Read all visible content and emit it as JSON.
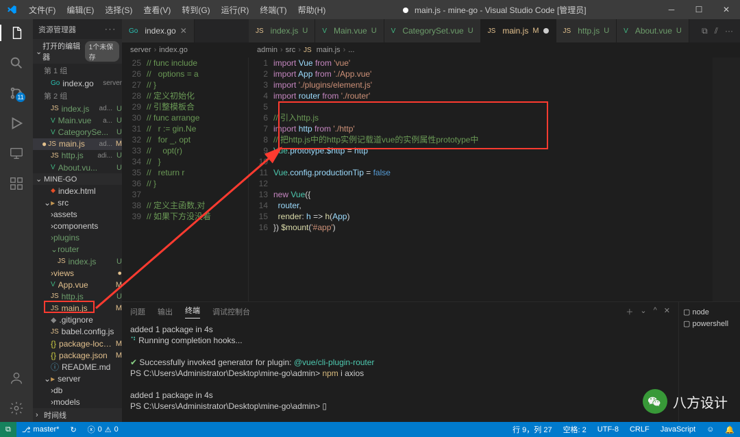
{
  "menu": [
    "文件(F)",
    "编辑(E)",
    "选择(S)",
    "查看(V)",
    "转到(G)",
    "运行(R)",
    "终端(T)",
    "帮助(H)"
  ],
  "title": {
    "filename": "main.js",
    "project": "mine-go",
    "app": "Visual Studio Code",
    "suffix": "[管理员]"
  },
  "sidebar": {
    "header": "资源管理器",
    "openEditors": {
      "label": "打开的编辑器",
      "badge": "1个未保存"
    },
    "groups": {
      "g1": "第 1 组",
      "g2": "第 2 组",
      "indexGo": {
        "name": "index.go",
        "dir": "server"
      },
      "indexJs": {
        "name": "index.js",
        "dir": "ad...",
        "stat": "U"
      },
      "mainVue": {
        "name": "Main.vue",
        "dir": "a...",
        "stat": "U"
      },
      "catSet": {
        "name": "CategorySe...",
        "stat": "U"
      },
      "mainJsOE": {
        "name": "main.js",
        "dir": "ad...",
        "stat": "M"
      },
      "httpJs": {
        "name": "http.js",
        "dir": "adi...",
        "stat": "U"
      },
      "aboutVue": {
        "name": "About.vu...",
        "stat": "U"
      }
    },
    "project": "MINE-GO",
    "tree": {
      "indexHtml": "index.html",
      "srcFolder": "src",
      "assets": "assets",
      "components": "components",
      "plugins": "plugins",
      "routerFolder": "router",
      "routerIndex": {
        "name": "index.js",
        "stat": "U"
      },
      "views": {
        "name": "views",
        "stat": "●"
      },
      "appVue": {
        "name": "App.vue",
        "stat": "M"
      },
      "httpJs": {
        "name": "http.js",
        "stat": "U"
      },
      "mainJs": {
        "name": "main.js",
        "stat": "M"
      },
      "gitignore": ".gitignore",
      "babel": {
        "name": "babel.config.js"
      },
      "pkgLock": {
        "name": "package-lock.j...",
        "stat": "M"
      },
      "pkg": {
        "name": "package.json",
        "stat": "M"
      },
      "readme": "README.md",
      "serverFolder": "server",
      "db": "db",
      "models": "models",
      "timeline": "时间线"
    }
  },
  "tabsLeft": [
    {
      "icon": "go",
      "name": "index.go",
      "close": true
    }
  ],
  "tabsRight": [
    {
      "icon": "js",
      "name": "index.js",
      "stat": "U",
      "cls": "u"
    },
    {
      "icon": "vue",
      "name": "Main.vue",
      "stat": "U",
      "cls": "u"
    },
    {
      "icon": "vue",
      "name": "CategorySet.vue",
      "stat": "U",
      "cls": "u"
    },
    {
      "icon": "js",
      "name": "main.js",
      "stat": "M",
      "cls": "m",
      "active": true,
      "dirty": true
    },
    {
      "icon": "js",
      "name": "http.js",
      "stat": "U",
      "cls": "u"
    },
    {
      "icon": "vue",
      "name": "About.vue",
      "stat": "U",
      "cls": "u"
    }
  ],
  "breadcrumbLeft": [
    "server",
    "index.go"
  ],
  "breadcrumbRight": [
    "admin",
    "src",
    "main.js",
    "..."
  ],
  "codeLeft": [
    {
      "n": 25,
      "html": "<span class='c-cmt'>// func include</span>"
    },
    {
      "n": 26,
      "html": "<span class='c-cmt'>//   options = a</span>"
    },
    {
      "n": 27,
      "html": "<span class='c-cmt'>// }</span>"
    },
    {
      "n": 28,
      "html": "<span class='c-cmt'>// 定义初始化</span>"
    },
    {
      "n": 29,
      "html": "<span class='c-cmt'>// 引整模板合</span>"
    },
    {
      "n": 30,
      "html": "<span class='c-cmt'>// func arrange</span>"
    },
    {
      "n": 31,
      "html": "<span class='c-cmt'>//   r := gin.Ne</span>"
    },
    {
      "n": 32,
      "html": "<span class='c-cmt'>//   for _, opt</span>"
    },
    {
      "n": 33,
      "html": "<span class='c-cmt'>//     opt(r)</span>"
    },
    {
      "n": 34,
      "html": "<span class='c-cmt'>//   }</span>"
    },
    {
      "n": 35,
      "html": "<span class='c-cmt'>//   return r</span>"
    },
    {
      "n": 36,
      "html": "<span class='c-cmt'>// }</span>"
    },
    {
      "n": 37,
      "html": ""
    },
    {
      "n": 38,
      "html": "<span class='c-cmt'>// 定义主函数,对</span>"
    },
    {
      "n": 39,
      "html": "<span class='c-cmt'>// 如果下方没没着</span>"
    }
  ],
  "codeRight": [
    {
      "n": 1,
      "html": "<span class='c-kw'>import</span> <span class='c-var'>Vue</span> <span class='c-kw'>from</span> <span class='c-str'>'vue'</span>"
    },
    {
      "n": 2,
      "html": "<span class='c-kw'>import</span> <span class='c-var'>App</span> <span class='c-kw'>from</span> <span class='c-str'>'./App.vue'</span>"
    },
    {
      "n": 3,
      "html": "<span class='c-kw'>import</span> <span class='c-str'>'./plugins/element.js'</span>"
    },
    {
      "n": 4,
      "html": "<span class='c-kw'>import</span> <span class='c-var'>router</span> <span class='c-kw'>from</span> <span class='c-str'>'./router'</span>"
    },
    {
      "n": 5,
      "html": ""
    },
    {
      "n": 6,
      "html": "<span class='c-cmt'>// 引入http.js</span>"
    },
    {
      "n": 7,
      "html": "<span class='c-kw'>import</span> <span class='c-var'>http</span> <span class='c-kw'>from</span> <span class='c-str'>'./http'</span>"
    },
    {
      "n": 8,
      "html": "<span class='c-cmt'>// 把http.js中的http实例记载道vue的实例属性prototype中</span>"
    },
    {
      "n": 9,
      "html": "<span class='c-cls'>Vue</span><span class='c-op'>.</span><span class='c-var'>prototype</span><span class='c-op'>.</span><span class='c-var'>$http</span> <span class='c-op'>=</span> <span class='c-var'>http</span>"
    },
    {
      "n": 10,
      "html": ""
    },
    {
      "n": 11,
      "html": "<span class='c-cls'>Vue</span><span class='c-op'>.</span><span class='c-var'>config</span><span class='c-op'>.</span><span class='c-var'>productionTip</span> <span class='c-op'>=</span> <span class='c-const'>false</span>"
    },
    {
      "n": 12,
      "html": ""
    },
    {
      "n": 13,
      "html": "<span class='c-kw'>new</span> <span class='c-cls'>Vue</span><span class='c-op'>({</span>"
    },
    {
      "n": 14,
      "html": "  <span class='c-var'>router</span><span class='c-op'>,</span>"
    },
    {
      "n": 15,
      "html": "  <span class='c-fn'>render</span><span class='c-op'>:</span> <span class='c-var'>h</span> <span class='c-op'>=></span> <span class='c-fn'>h</span><span class='c-op'>(</span><span class='c-var'>App</span><span class='c-op'>)</span>"
    },
    {
      "n": 16,
      "html": "<span class='c-op'>}) </span><span class='c-fn'>$mount</span><span class='c-op'>(</span><span class='c-str'>'#app'</span><span class='c-op'>)</span>"
    }
  ],
  "panel": {
    "tabs": [
      "问题",
      "输出",
      "终端",
      "调试控制台"
    ],
    "lines": [
      {
        "html": "added 1 package in 4s"
      },
      {
        "html": "<span class='t-cyan'>⠙</span> Running completion hooks..."
      },
      {
        "html": ""
      },
      {
        "html": "<span class='t-green'>✔</span>  Successfully invoked generator for plugin: <span class='t-cyan'>@vue/cli-plugin-router</span>"
      },
      {
        "html": "PS C:\\Users\\Administrator\\Desktop\\mine-go\\admin> <span class='t-yel'>npm</span> i axios"
      },
      {
        "html": ""
      },
      {
        "html": "added 1 package in 4s"
      },
      {
        "html": "PS C:\\Users\\Administrator\\Desktop\\mine-go\\admin> ▯"
      }
    ],
    "side": [
      "node",
      "powershell"
    ]
  },
  "status": {
    "branch": "master*",
    "sync": "↻",
    "errors": "0",
    "warnings": "0",
    "pos": "行 9，列 27",
    "spaces": "空格: 2",
    "encoding": "UTF-8",
    "eol": "CRLF",
    "lang": "JavaScript"
  },
  "watermark": "八方设计"
}
